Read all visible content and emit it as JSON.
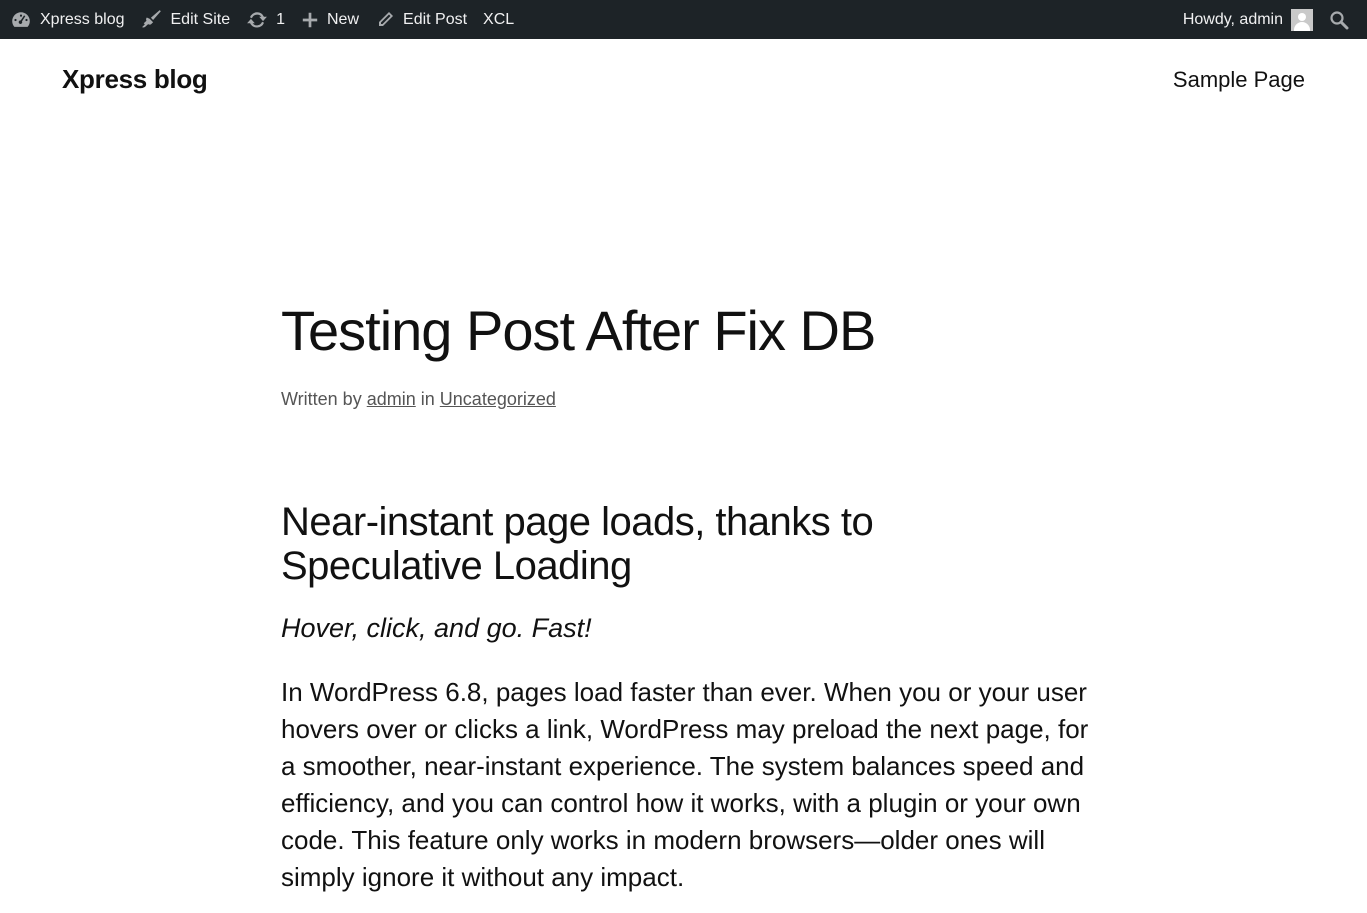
{
  "admin_bar": {
    "site_name": "Xpress blog",
    "edit_site": "Edit Site",
    "updates_count": "1",
    "new": "New",
    "edit_post": "Edit Post",
    "xcl": "XCL",
    "howdy": "Howdy, admin",
    "background_color": "#1d2327"
  },
  "header": {
    "site_title": "Xpress blog",
    "nav": [
      "Sample Page"
    ]
  },
  "post": {
    "title": "Testing Post After Fix DB",
    "byline": {
      "written_by": "Written by",
      "author": "admin",
      "in": "in",
      "category": "Uncategorized"
    },
    "heading": "Near-instant page loads, thanks to Speculative Loading",
    "tagline": "Hover, click, and go. Fast!",
    "paragraph": "In WordPress 6.8, pages load faster than ever. When you or your user hovers over or clicks a link, WordPress may preload the next page, for a smoother, near-instant experience. The system balances speed and efficiency, and you can control how it works, with a plugin or your own code. This feature only works in modern browsers—older ones will simply ignore it without any impact."
  }
}
